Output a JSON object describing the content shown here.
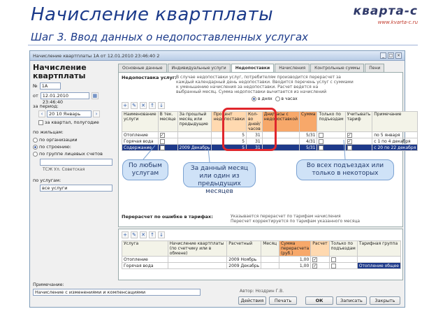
{
  "slide": {
    "title": "Начисление квартплаты",
    "subtitle": "Шаг 3.  Ввод данных о недопоставленных услугах",
    "logo_main": "кварта-с",
    "logo_url": "www.kvarta-c.ru"
  },
  "window": {
    "title": "Начисление квартплаты 1А от 12.01.2010 23:46:40 2",
    "left": {
      "heading1": "Начисление",
      "heading2": "квартплаты",
      "num_label": "№",
      "num_value": "1А",
      "date_label": "от",
      "date_value": "12.01.2010 23:46:40",
      "period_label": "за период:",
      "period_value": "20 10 Январь",
      "prior_check_label": "за квартал, полугодие",
      "by_label": "по жильцам:",
      "opt1": "по организации",
      "opt2": "по строению:",
      "opt2_value": "",
      "opt3": "по группе лицевых счетов",
      "opt3_value": "",
      "small_note": "ТСЖ Ул. Советская",
      "from_label": "по услугам:",
      "from_value": "все услуги"
    },
    "tabs": [
      "Основные данные",
      "Индивидуальные услуги",
      "Недопоставки",
      "Начисления",
      "Контрольные суммы",
      "Пени"
    ],
    "active_tab": 2,
    "panel": {
      "undeliver_label": "Недопоставка услуг:",
      "undeliver_desc1": "В случае недопоставки услуг, потребителям производится перерасчет за",
      "undeliver_desc2": "каждый календарный день недопоставки. Вводится перечень услуг с суммами",
      "undeliver_desc3": "к уменьшению начисления за недопоставки. Расчет ведется на",
      "undeliver_desc4": "выбранный месяц. Сумма недопоставки вычитается из начислений",
      "radio1": "в днях",
      "radio2": "в часах",
      "cols": [
        "Наименование услуги",
        "В тек. месяце",
        "За прошлый месяц или предыдущие",
        "Процент недопоставки",
        "Кол-во дней/часов",
        "Дни/часы с недопоставкой",
        "Сумма",
        "Только по подъездам",
        "Учитывать тариф",
        "Примечание"
      ],
      "rows": [
        {
          "service": "Отопление",
          "cur": "✓",
          "period": "",
          "pct": "5",
          "days": "31",
          "hours": "",
          "sum": "5/31",
          "pod": "",
          "flag": "✓",
          "note": "по 5 января"
        },
        {
          "service": "Горячая вода",
          "cur": "",
          "period": "",
          "pct": "5",
          "days": "31",
          "hours": "",
          "sum": "4/31",
          "pod": "",
          "flag": "✓",
          "note": "с 1 по 4 декабря"
        },
        {
          "service": "Содержание",
          "cur": "",
          "period": "2009 Декабрь",
          "pct": "5",
          "days": "31",
          "hours": "",
          "sum": "5/31",
          "pod": "",
          "flag": "✓",
          "note": "с 20 по 22 декабря"
        }
      ],
      "recalc_label": "Перерасчет по ошибке в тарифах:",
      "recalc_desc1": "Указывается перерасчет по тарифам начисления",
      "recalc_desc2": "Пересчет корректируется по тарифам указанного месяца",
      "cols2": [
        "Услуга",
        "Начисление квартплаты (по счетчику или в обмене)",
        "Расчетный",
        "Месяц",
        "Сумма перерасчета (руб.)",
        "Расчет",
        "Только по подъездам",
        "Тарифная группа"
      ],
      "rows2": [
        {
          "service": "Отопление",
          "doc": "",
          "calc": "2009 Ноябрь",
          "month": "",
          "sum": "1,00",
          "flag": "✓",
          "group": ""
        },
        {
          "service": "Горячая вода",
          "doc": "",
          "calc": "2009 Декабрь",
          "month": "",
          "sum": "1,00",
          "flag": "✓",
          "group": "Отопление общее"
        }
      ]
    },
    "bottom": {
      "comment_label": "Примечание:",
      "comment_value": "Начисление с изменениями и компенсациями",
      "author": "Автор: Ноздрин Г.В.",
      "btn_actions": "Действия",
      "btn_print": "Печать",
      "btn_ok": "ОК",
      "btn_save": "Записать",
      "btn_close": "Закрыть"
    }
  },
  "callouts": {
    "c1": "По любым услугам",
    "c2": "За данный месяц или один из предыдущих месяцев",
    "c3": "Во всех подъездах или только в некоторых"
  }
}
